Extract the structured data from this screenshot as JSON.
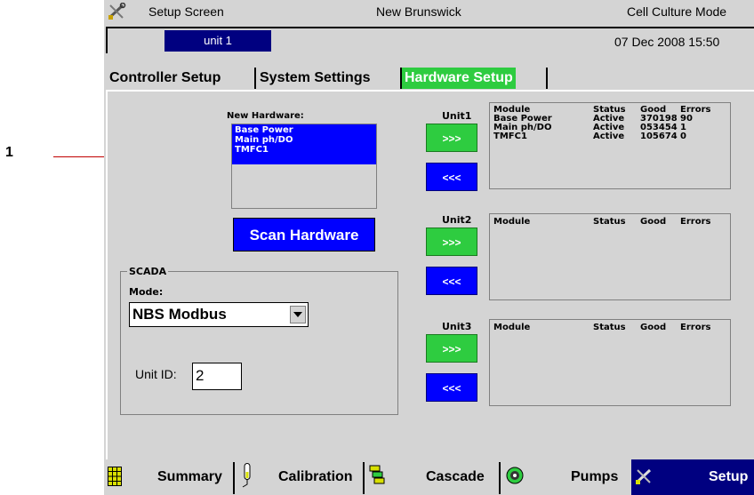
{
  "callout": {
    "number": "1"
  },
  "titlebar": {
    "icon": "wrench-screwdriver-icon",
    "screen_name": "Setup Screen",
    "brand": "New Brunswick",
    "mode": "Cell Culture Mode"
  },
  "unitbar": {
    "unit_tab": "unit 1",
    "datetime": "07 Dec 2008  15:50"
  },
  "tabs": [
    {
      "label": "Controller Setup",
      "active": false
    },
    {
      "label": "System Settings",
      "active": false
    },
    {
      "label": "Hardware Setup",
      "active": true
    }
  ],
  "new_hardware": {
    "label": "New Hardware:",
    "items": [
      "Base Power",
      "Main ph/DO",
      "TMFC1"
    ],
    "scan_button": "Scan Hardware"
  },
  "scada": {
    "legend": "SCADA",
    "mode_label": "Mode:",
    "mode_value": "NBS Modbus",
    "unit_id_label": "Unit ID:",
    "unit_id_value": "2"
  },
  "buttons": {
    "add": ">>>",
    "remove": "<<<"
  },
  "units": [
    {
      "label": "Unit1",
      "headers": [
        "Module",
        "Status",
        "Good",
        "Errors"
      ],
      "rows": [
        [
          "Base Power",
          "Active",
          "370198",
          "90"
        ],
        [
          "Main ph/DO",
          "Active",
          "053454",
          "1"
        ],
        [
          "TMFC1",
          "Active",
          "105674",
          "0"
        ]
      ]
    },
    {
      "label": "Unit2",
      "headers": [
        "Module",
        "Status",
        "Good",
        "Errors"
      ],
      "rows": []
    },
    {
      "label": "Unit3",
      "headers": [
        "Module",
        "Status",
        "Good",
        "Errors"
      ],
      "rows": []
    }
  ],
  "bottom_nav": [
    {
      "label": "Summary",
      "icon": "grid-table-icon"
    },
    {
      "label": "Calibration",
      "icon": "probe-icon"
    },
    {
      "label": "Cascade",
      "icon": "cascade-icon"
    },
    {
      "label": "Pumps",
      "icon": "pump-icon"
    },
    {
      "label": "Setup",
      "icon": "wrench-screwdriver-icon",
      "active": true
    }
  ],
  "colors": {
    "panel": "#d4d4d4",
    "active_green": "#2ecc40",
    "button_blue": "#0000ff",
    "navy": "#000080",
    "callout_line": "#c00000"
  }
}
